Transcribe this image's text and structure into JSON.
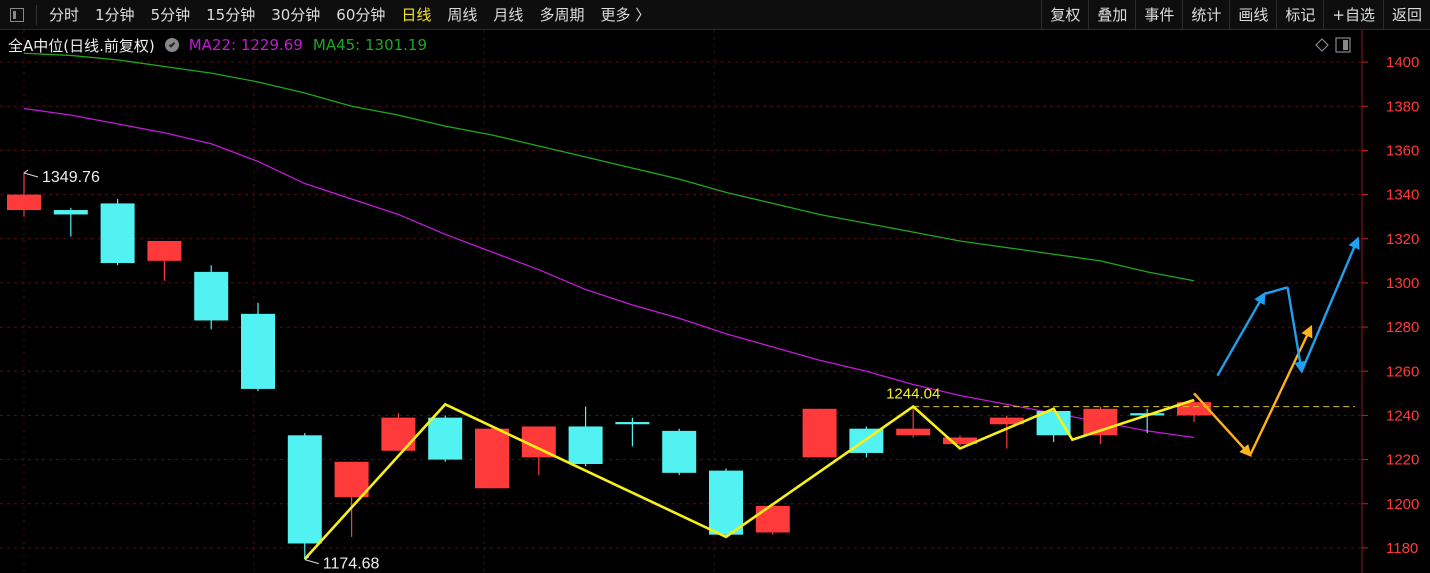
{
  "toolbar": {
    "periods": [
      "分时",
      "1分钟",
      "5分钟",
      "15分钟",
      "30分钟",
      "60分钟",
      "日线",
      "周线",
      "月线",
      "多周期",
      "更多 〉"
    ],
    "active_period": "日线",
    "tools": [
      "复权",
      "叠加",
      "事件",
      "统计",
      "画线",
      "标记",
      "+自选",
      "返回"
    ]
  },
  "legend": {
    "title": "全A中位(日线.前复权)",
    "ma22_label": "MA22: 1229.69",
    "ma45_label": "MA45: 1301.19",
    "ma22_color": "#c21ad8",
    "ma45_color": "#1fa81f"
  },
  "chart_data": {
    "type": "candlestick",
    "title": "全A中位(日线.前复权)",
    "ylim": [
      1170,
      1410
    ],
    "yticks": [
      1180,
      1200,
      1220,
      1240,
      1260,
      1280,
      1300,
      1320,
      1340,
      1360,
      1380,
      1400
    ],
    "up_color": "#ff3a3a",
    "down_color": "#52f2f2",
    "candles": [
      {
        "o": 1333,
        "c": 1340,
        "h": 1350,
        "l": 1330
      },
      {
        "o": 1333,
        "c": 1331,
        "h": 1334,
        "l": 1321
      },
      {
        "o": 1336,
        "c": 1309,
        "h": 1338,
        "l": 1308
      },
      {
        "o": 1310,
        "c": 1319,
        "h": 1319,
        "l": 1301
      },
      {
        "o": 1305,
        "c": 1283,
        "h": 1308,
        "l": 1279
      },
      {
        "o": 1286,
        "c": 1252,
        "h": 1291,
        "l": 1251
      },
      {
        "o": 1231,
        "c": 1182,
        "h": 1232,
        "l": 1175
      },
      {
        "o": 1203,
        "c": 1219,
        "h": 1219,
        "l": 1185
      },
      {
        "o": 1224,
        "c": 1239,
        "h": 1241,
        "l": 1224
      },
      {
        "o": 1239,
        "c": 1220,
        "h": 1240,
        "l": 1219
      },
      {
        "o": 1207,
        "c": 1234,
        "h": 1235,
        "l": 1207
      },
      {
        "o": 1221,
        "c": 1235,
        "h": 1235,
        "l": 1213
      },
      {
        "o": 1235,
        "c": 1218,
        "h": 1244,
        "l": 1217
      },
      {
        "o": 1237,
        "c": 1236,
        "h": 1239,
        "l": 1226
      },
      {
        "o": 1233,
        "c": 1214,
        "h": 1234,
        "l": 1213
      },
      {
        "o": 1215,
        "c": 1186,
        "h": 1216,
        "l": 1185
      },
      {
        "o": 1187,
        "c": 1199,
        "h": 1199,
        "l": 1186
      },
      {
        "o": 1221,
        "c": 1243,
        "h": 1243,
        "l": 1221
      },
      {
        "o": 1234,
        "c": 1223,
        "h": 1235,
        "l": 1221
      },
      {
        "o": 1231,
        "c": 1234,
        "h": 1244,
        "l": 1230
      },
      {
        "o": 1227,
        "c": 1230,
        "h": 1231,
        "l": 1226
      },
      {
        "o": 1236,
        "c": 1239,
        "h": 1240,
        "l": 1225
      },
      {
        "o": 1242,
        "c": 1231,
        "h": 1242,
        "l": 1228
      },
      {
        "o": 1231,
        "c": 1243,
        "h": 1244,
        "l": 1227
      },
      {
        "o": 1241,
        "c": 1240,
        "h": 1243,
        "l": 1232
      },
      {
        "o": 1240,
        "c": 1246,
        "h": 1247,
        "l": 1237
      }
    ],
    "ma22": [
      1379,
      1376,
      1372,
      1368,
      1363,
      1355,
      1345,
      1338,
      1331,
      1322,
      1314,
      1306,
      1297,
      1290,
      1284,
      1277,
      1271,
      1265,
      1260,
      1254,
      1249,
      1245,
      1241,
      1237,
      1233,
      1230
    ],
    "ma45": [
      1404,
      1403,
      1401,
      1398,
      1395,
      1391,
      1386,
      1380,
      1376,
      1371,
      1367,
      1362,
      1357,
      1352,
      1347,
      1341,
      1336,
      1331,
      1327,
      1323,
      1319,
      1316,
      1313,
      1310,
      1305,
      1301
    ],
    "ref_level": 1244,
    "annotations": [
      {
        "text": "1349.76",
        "index": 0,
        "value": 1349.76
      },
      {
        "text": "1174.68",
        "index": 6,
        "value": 1174.68
      },
      {
        "text": "1244.04",
        "index": 19,
        "value": 1244.04
      }
    ],
    "yellow_path": [
      [
        6,
        1175
      ],
      [
        9,
        1245
      ],
      [
        15,
        1185
      ],
      [
        19,
        1244
      ],
      [
        20,
        1225
      ],
      [
        22,
        1243
      ],
      [
        22.4,
        1229
      ],
      [
        25,
        1247
      ]
    ],
    "orange_projection": [
      [
        25,
        1250
      ],
      [
        26.2,
        1222
      ],
      [
        27.5,
        1280
      ]
    ],
    "blue_projection": [
      [
        25.5,
        1258
      ],
      [
        26.5,
        1295
      ],
      [
        27,
        1298
      ],
      [
        27.3,
        1260
      ],
      [
        28.5,
        1320
      ]
    ]
  }
}
